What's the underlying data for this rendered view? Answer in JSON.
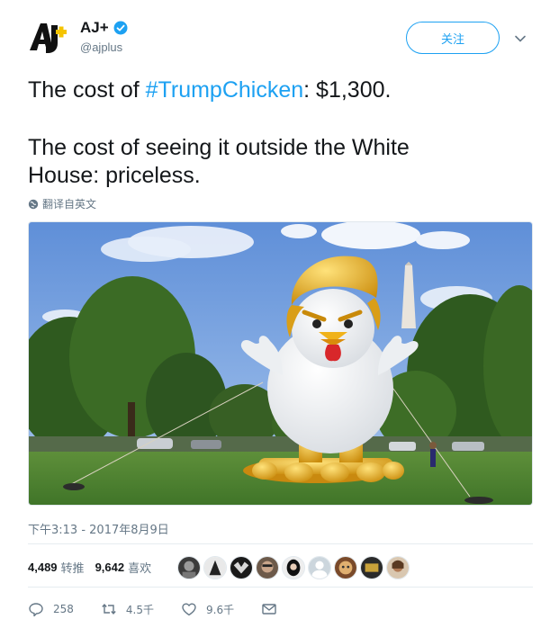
{
  "account": {
    "display_name": "AJ+",
    "handle": "@ajplus",
    "logo_text": "AJ+",
    "verified": true
  },
  "header": {
    "follow_label": "关注",
    "menu_icon": "chevron-down-icon"
  },
  "tweet": {
    "line1_prefix": "The cost of ",
    "hashtag": "#TrumpChicken",
    "line1_suffix": ": $1,300.",
    "line2": "The cost of seeing it outside the White",
    "line3": "House: priceless.",
    "translate_label": "翻译自英文"
  },
  "timestamp": "下午3:13 - 2017年8月9日",
  "stats": {
    "retweets_count": "4,489",
    "retweets_label": "转推",
    "likes_count": "9,642",
    "likes_label": "喜欢"
  },
  "actions": {
    "reply_count": "258",
    "retweet_count": "4.5千",
    "like_count": "9.6千"
  },
  "colors": {
    "accent": "#1da1f2",
    "text": "#14171a",
    "secondary": "#657786",
    "logo_yellow": "#f5c400"
  }
}
